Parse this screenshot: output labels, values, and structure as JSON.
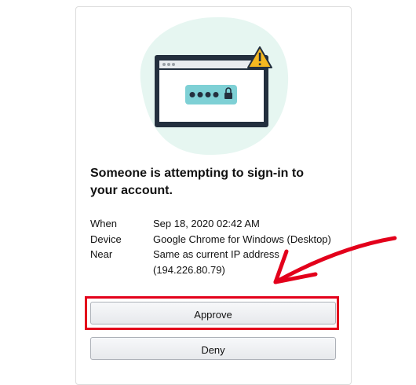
{
  "prompt": {
    "title": "Someone is attempting to sign-in to your account."
  },
  "details": {
    "when_label": "When",
    "when_value": "Sep 18, 2020 02:42 AM",
    "device_label": "Device",
    "device_value": "Google Chrome for Windows (Desktop)",
    "near_label": "Near",
    "near_value_line1": "Same as current IP address",
    "near_value_line2": "(194.226.80.79)"
  },
  "actions": {
    "approve_label": "Approve",
    "deny_label": "Deny"
  },
  "colors": {
    "highlight": "#e3001b",
    "illustration_bg": "#e6f6f1",
    "browser_frame": "#232f3e",
    "password_field": "#7ed0d5",
    "warning": "#f5b820"
  },
  "icons": [
    "browser-window-icon",
    "password-lock-icon",
    "warning-icon",
    "arrow-annotation"
  ]
}
